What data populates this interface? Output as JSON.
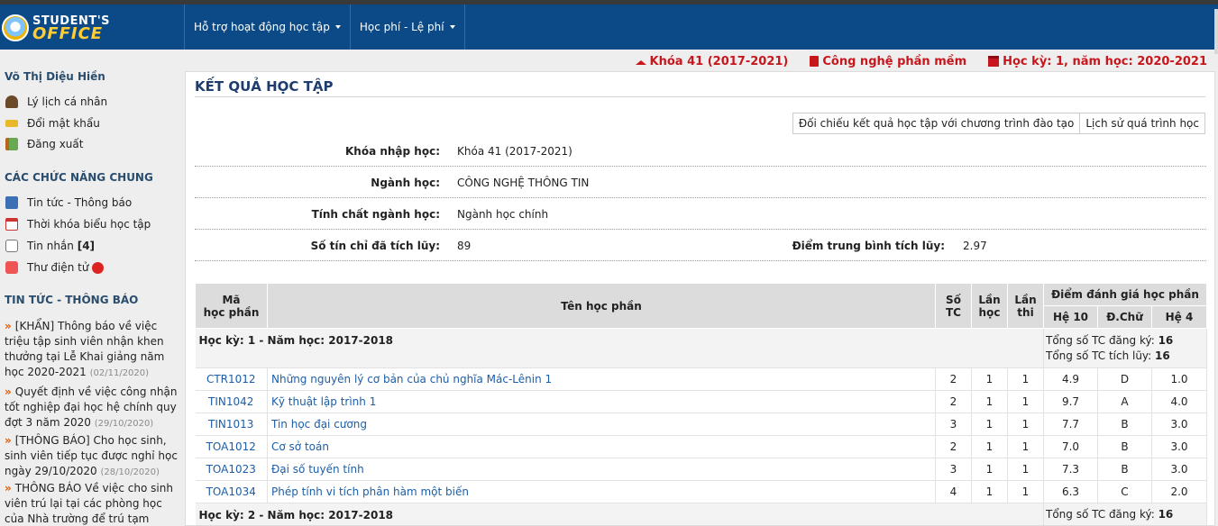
{
  "header": {
    "logo_line1": "STUDENT'S",
    "logo_line2": "OFFICE",
    "menu": [
      {
        "label": "Hỗ trợ hoạt động học tập"
      },
      {
        "label": "Học phí - Lệ phí"
      }
    ]
  },
  "infobar": {
    "course": "Khóa 41 (2017-2021)",
    "major": "Công nghệ phần mềm",
    "semester": "Học kỳ: 1, năm học: 2020-2021"
  },
  "sidebar": {
    "user_name": "Võ Thị Diệu Hiền",
    "user_links": [
      "Lý lịch cá nhân",
      "Đổi mật khẩu",
      "Đăng xuất"
    ],
    "common_heading": "CÁC CHỨC NĂNG CHUNG",
    "common_links": [
      "Tin tức - Thông báo",
      "Thời khóa biểu học tập",
      "Tin nhắn",
      "Thư điện tử"
    ],
    "message_count": "[4]",
    "news_heading": "TIN TỨC - THÔNG BÁO",
    "news": [
      {
        "text": "[KHẨN] Thông báo về việc triệu tập sinh viên nhận khen thưởng tại Lễ Khai giảng năm học 2020-2021",
        "date": "(02/11/2020)"
      },
      {
        "text": "Quyết định về việc công nhận tốt nghiệp đại học hệ chính quy đợt 3 năm 2020",
        "date": "(29/10/2020)"
      },
      {
        "text": "[THÔNG BÁO] Cho học sinh, sinh viên tiếp tục được nghỉ học ngày 29/10/2020",
        "date": "(28/10/2020)"
      },
      {
        "text": "THÔNG BÁO Về việc cho sinh viên trú lại tại các phòng học của Nhà trường để trú tạm tránh bão",
        "date": ""
      }
    ]
  },
  "main": {
    "title": "KẾT QUẢ HỌC TẬP",
    "buttons": [
      "Đối chiếu kết quả học tập với chương trình đào tạo",
      "Lịch sử quá trình học"
    ],
    "info": {
      "khoa_label": "Khóa nhập học:",
      "khoa_value": "Khóa 41 (2017-2021)",
      "nganh_label": "Ngành học:",
      "nganh_value": "CÔNG NGHỆ THÔNG TIN",
      "tinhchat_label": "Tính chất ngành học:",
      "tinhchat_value": "Ngành học chính",
      "tinchi_label": "Số tín chỉ đã tích lũy:",
      "tinchi_value": "89",
      "diemtb_label": "Điểm trung bình tích lũy:",
      "diemtb_value": "2.97"
    },
    "table": {
      "headers": {
        "ma_line1": "Mã",
        "ma_line2": "học phần",
        "ten": "Tên học phần",
        "sotc_line1": "Số",
        "sotc_line2": "TC",
        "lanhoc_line1": "Lần",
        "lanhoc_line2": "học",
        "lanthi_line1": "Lần",
        "lanthi_line2": "thi",
        "diem": "Điểm đánh giá học phần",
        "he10": "Hệ 10",
        "dchu": "Đ.Chữ",
        "he4": "Hệ 4"
      },
      "sem1": {
        "title": "Học kỳ: 1 - Năm học: 2017-2018",
        "reg_label": "Tổng số TC đăng ký:",
        "reg_value": "16",
        "acc_label": "Tổng số TC tích lũy:",
        "acc_value": "16"
      },
      "rows": [
        {
          "code": "CTR1012",
          "name": "Những nguyên lý cơ bản của chủ nghĩa Mác-Lênin 1",
          "tc": "2",
          "lanhoc": "1",
          "lanthi": "1",
          "he10": "4.9",
          "chu": "D",
          "he4": "1.0"
        },
        {
          "code": "TIN1042",
          "name": "Kỹ thuật lập trình 1",
          "tc": "2",
          "lanhoc": "1",
          "lanthi": "1",
          "he10": "9.7",
          "chu": "A",
          "he4": "4.0"
        },
        {
          "code": "TIN1013",
          "name": "Tin học đại cương",
          "tc": "3",
          "lanhoc": "1",
          "lanthi": "1",
          "he10": "7.7",
          "chu": "B",
          "he4": "3.0"
        },
        {
          "code": "TOA1012",
          "name": "Cơ sở toán",
          "tc": "2",
          "lanhoc": "1",
          "lanthi": "1",
          "he10": "7.0",
          "chu": "B",
          "he4": "3.0"
        },
        {
          "code": "TOA1023",
          "name": "Đại số tuyến tính",
          "tc": "3",
          "lanhoc": "1",
          "lanthi": "1",
          "he10": "7.3",
          "chu": "B",
          "he4": "3.0"
        },
        {
          "code": "TOA1034",
          "name": "Phép tính vi tích phân hàm một biến",
          "tc": "4",
          "lanhoc": "1",
          "lanthi": "1",
          "he10": "6.3",
          "chu": "C",
          "he4": "2.0"
        }
      ],
      "sem2": {
        "title": "Học kỳ: 2 - Năm học: 2017-2018",
        "reg_label": "Tổng số TC đăng ký:",
        "reg_value": "16"
      }
    }
  },
  "colors": {
    "navbar": "#0b4a86",
    "accent_red": "#c8161d",
    "link_blue": "#1c5ea8",
    "heading": "#1f3c6e"
  }
}
